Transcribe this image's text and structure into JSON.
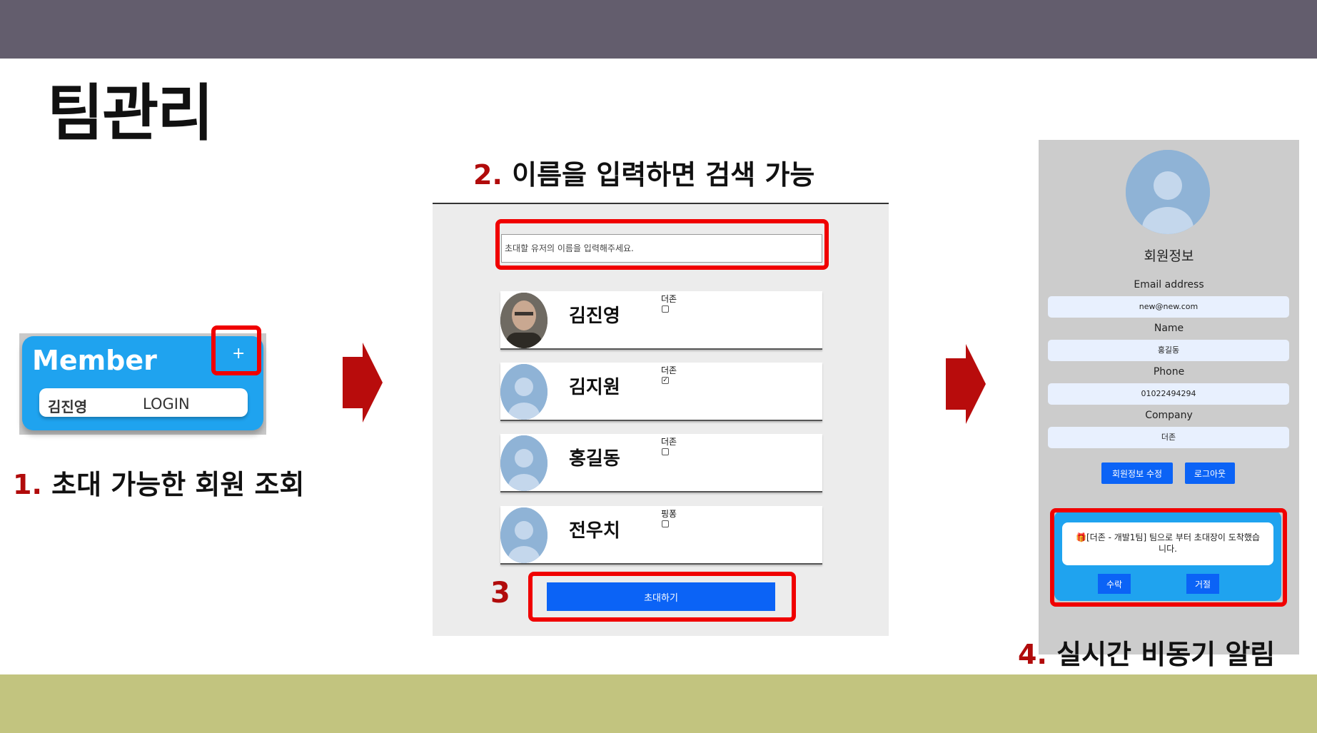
{
  "slide": {
    "title": "팀관리",
    "colors": {
      "top_bar": "#635d6d",
      "bottom_bar": "#c2c47f",
      "accent_red": "#b10b0b",
      "highlight_red": "#f00000",
      "primary_blue": "#0b63f6",
      "widget_blue": "#1fa3ef"
    }
  },
  "step1": {
    "number": "1.",
    "caption": " 초대 가능한 회원 조회",
    "widget": {
      "title": "Member",
      "add_icon": "+",
      "member_name": "김진영",
      "login_label": "LOGIN"
    }
  },
  "step2": {
    "number": "2.",
    "caption": " 이름을 입력하면 검색 가능",
    "search_placeholder": "초대할 유저의 이름을 입력해주세요.",
    "users": [
      {
        "name": "김진영",
        "company": "더존",
        "checked": false,
        "avatar": "photo-avatar"
      },
      {
        "name": "김지원",
        "company": "더존",
        "checked": true,
        "avatar": "default-avatar"
      },
      {
        "name": "홍길동",
        "company": "더존",
        "checked": false,
        "avatar": "default-avatar"
      },
      {
        "name": "전우치",
        "company": "핑퐁",
        "checked": false,
        "avatar": "default-avatar"
      }
    ],
    "invite_button": "초대하기"
  },
  "step3": {
    "label": "3"
  },
  "step4": {
    "number": "4.",
    "caption": " 실시간 비동기 알림",
    "profile": {
      "heading": "회원정보",
      "fields": [
        {
          "label": "Email address",
          "value": "new@new.com"
        },
        {
          "label": "Name",
          "value": "홍길동"
        },
        {
          "label": "Phone",
          "value": "01022494294"
        },
        {
          "label": "Company",
          "value": "더존"
        }
      ],
      "edit_button": "회원정보 수정",
      "logout_button": "로그아웃",
      "notification": {
        "gift_icon": "🎁",
        "message": "[더존 - 개발1팀] 팀으로 부터 초대장이 도착했습니다.",
        "accept_button": "수락",
        "reject_button": "거절"
      }
    }
  }
}
